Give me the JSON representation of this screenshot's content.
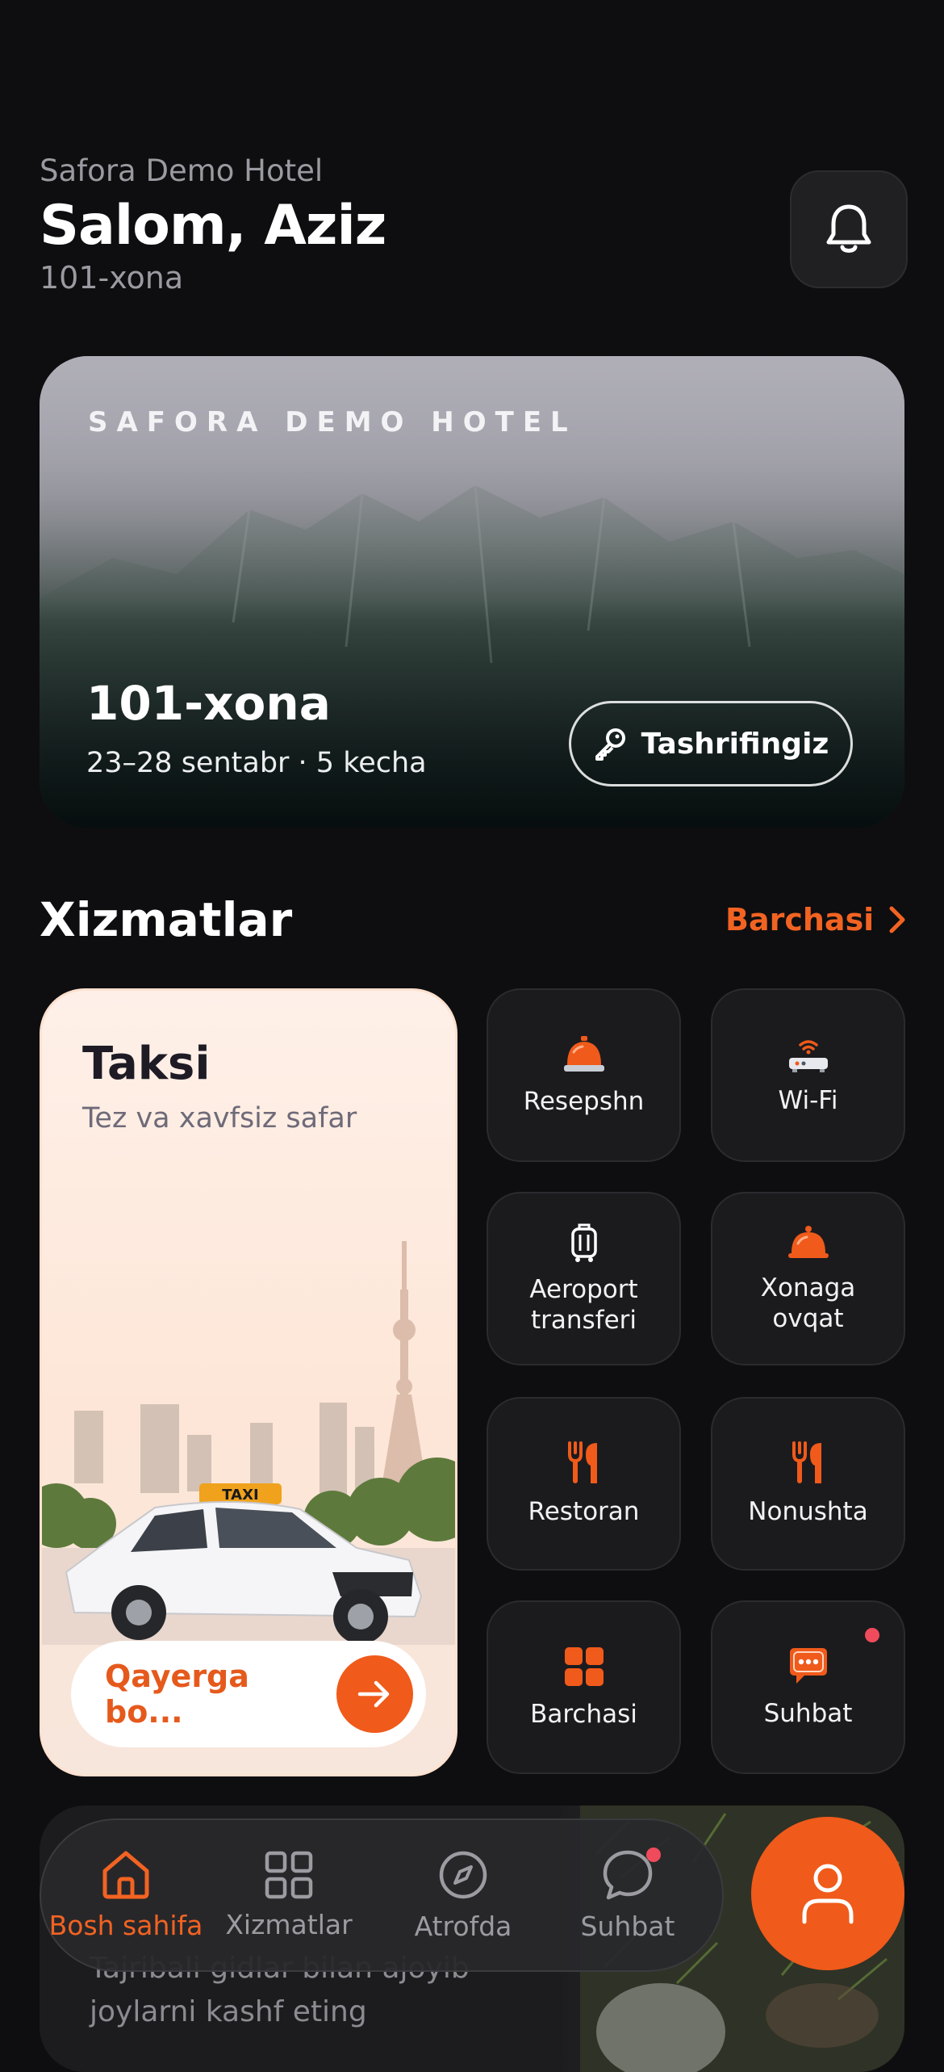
{
  "header": {
    "hotel_name": "Safora Demo Hotel",
    "greeting": "Salom, Aziz",
    "room": "101-xona"
  },
  "hero": {
    "eyebrow": "SAFORA DEMO HOTEL",
    "room": "101-xona",
    "dates": "23–28 sentabr · 5 kecha",
    "button_label": "Tashrifingiz"
  },
  "services": {
    "title": "Xizmatlar",
    "see_all": "Barchasi",
    "taxi": {
      "title": "Taksi",
      "subtitle": "Tez va xavfsiz safar",
      "input_placeholder": "Qayerga bo...",
      "roof_sign": "TAXI"
    },
    "tiles": [
      {
        "label": "Resepshn",
        "icon": "reception-bell-icon"
      },
      {
        "label": "Wi-Fi",
        "icon": "wifi-router-icon"
      },
      {
        "label": "Aeroport\ntransferi",
        "icon": "luggage-icon"
      },
      {
        "label": "Xonaga\novqat",
        "icon": "room-service-cloche-icon"
      },
      {
        "label": "Restoran",
        "icon": "fork-knife-icon"
      },
      {
        "label": "Nonushta",
        "icon": "fork-knife-icon"
      },
      {
        "label": "Barchasi",
        "icon": "grid-icon"
      },
      {
        "label": "Suhbat",
        "icon": "chat-bubble-icon",
        "badge": true
      }
    ]
  },
  "promo": {
    "text": "Tajribali gidlar bilan ajoyib\njoylarni kashf eting"
  },
  "nav": {
    "items": [
      {
        "label": "Bosh sahifa",
        "icon": "home-icon",
        "active": true
      },
      {
        "label": "Xizmatlar",
        "icon": "grid-icon",
        "active": false
      },
      {
        "label": "Atrofda",
        "icon": "compass-icon",
        "active": false
      },
      {
        "label": "Suhbat",
        "icon": "chat-icon",
        "active": false,
        "badge": true
      }
    ]
  },
  "colors": {
    "background": "#0e0e10",
    "accent": "#f26322",
    "badge": "#ef4b5c",
    "tile": "#1b1b1e"
  }
}
